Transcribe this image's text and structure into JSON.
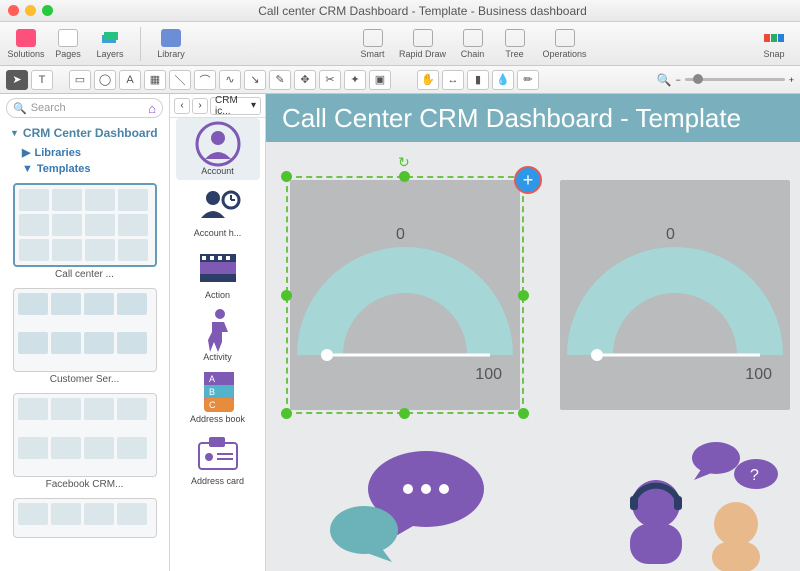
{
  "window": {
    "title": "Call center CRM Dashboard - Template - Business dashboard"
  },
  "toolbar1": {
    "solutions": "Solutions",
    "pages": "Pages",
    "layers": "Layers",
    "library": "Library",
    "smart": "Smart",
    "rapid": "Rapid Draw",
    "chain": "Chain",
    "tree": "Tree",
    "operations": "Operations",
    "snap": "Snap"
  },
  "sidebar": {
    "search_placeholder": "Search",
    "heading": "CRM Center Dashboard",
    "libraries": "Libraries",
    "templates": "Templates",
    "thumbs": [
      {
        "label": "Call center ..."
      },
      {
        "label": "Customer Ser..."
      },
      {
        "label": "Facebook CRM..."
      },
      {
        "label": ""
      }
    ]
  },
  "library": {
    "dropdown": "CRM ic...",
    "items": [
      {
        "label": "Account"
      },
      {
        "label": "Account h..."
      },
      {
        "label": "Action"
      },
      {
        "label": "Activity"
      },
      {
        "label": "Address book"
      },
      {
        "label": "Address card"
      }
    ]
  },
  "canvas": {
    "title": "Call Center CRM Dashboard - Template",
    "gauge1": {
      "top": "0",
      "max": "100"
    },
    "gauge2": {
      "top": "0",
      "max": "100"
    }
  },
  "colors": {
    "accent": "#7ab0bd",
    "purple": "#7e5ab5",
    "teal": "#8fd0d4",
    "mint": "#a6d6d5"
  }
}
